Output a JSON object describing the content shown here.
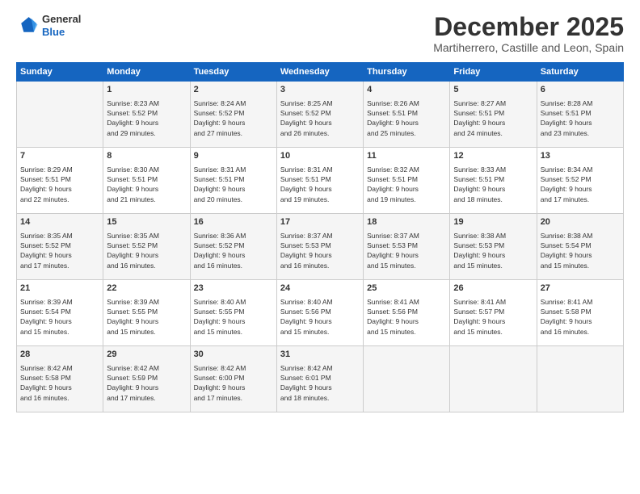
{
  "header": {
    "logo": {
      "line1": "General",
      "line2": "Blue"
    },
    "title": "December 2025",
    "subtitle": "Martiherrero, Castille and Leon, Spain"
  },
  "calendar": {
    "weekdays": [
      "Sunday",
      "Monday",
      "Tuesday",
      "Wednesday",
      "Thursday",
      "Friday",
      "Saturday"
    ],
    "weeks": [
      [
        {
          "day": "",
          "info": ""
        },
        {
          "day": "1",
          "info": "Sunrise: 8:23 AM\nSunset: 5:52 PM\nDaylight: 9 hours\nand 29 minutes."
        },
        {
          "day": "2",
          "info": "Sunrise: 8:24 AM\nSunset: 5:52 PM\nDaylight: 9 hours\nand 27 minutes."
        },
        {
          "day": "3",
          "info": "Sunrise: 8:25 AM\nSunset: 5:52 PM\nDaylight: 9 hours\nand 26 minutes."
        },
        {
          "day": "4",
          "info": "Sunrise: 8:26 AM\nSunset: 5:51 PM\nDaylight: 9 hours\nand 25 minutes."
        },
        {
          "day": "5",
          "info": "Sunrise: 8:27 AM\nSunset: 5:51 PM\nDaylight: 9 hours\nand 24 minutes."
        },
        {
          "day": "6",
          "info": "Sunrise: 8:28 AM\nSunset: 5:51 PM\nDaylight: 9 hours\nand 23 minutes."
        }
      ],
      [
        {
          "day": "7",
          "info": "Sunrise: 8:29 AM\nSunset: 5:51 PM\nDaylight: 9 hours\nand 22 minutes."
        },
        {
          "day": "8",
          "info": "Sunrise: 8:30 AM\nSunset: 5:51 PM\nDaylight: 9 hours\nand 21 minutes."
        },
        {
          "day": "9",
          "info": "Sunrise: 8:31 AM\nSunset: 5:51 PM\nDaylight: 9 hours\nand 20 minutes."
        },
        {
          "day": "10",
          "info": "Sunrise: 8:31 AM\nSunset: 5:51 PM\nDaylight: 9 hours\nand 19 minutes."
        },
        {
          "day": "11",
          "info": "Sunrise: 8:32 AM\nSunset: 5:51 PM\nDaylight: 9 hours\nand 19 minutes."
        },
        {
          "day": "12",
          "info": "Sunrise: 8:33 AM\nSunset: 5:51 PM\nDaylight: 9 hours\nand 18 minutes."
        },
        {
          "day": "13",
          "info": "Sunrise: 8:34 AM\nSunset: 5:52 PM\nDaylight: 9 hours\nand 17 minutes."
        }
      ],
      [
        {
          "day": "14",
          "info": "Sunrise: 8:35 AM\nSunset: 5:52 PM\nDaylight: 9 hours\nand 17 minutes."
        },
        {
          "day": "15",
          "info": "Sunrise: 8:35 AM\nSunset: 5:52 PM\nDaylight: 9 hours\nand 16 minutes."
        },
        {
          "day": "16",
          "info": "Sunrise: 8:36 AM\nSunset: 5:52 PM\nDaylight: 9 hours\nand 16 minutes."
        },
        {
          "day": "17",
          "info": "Sunrise: 8:37 AM\nSunset: 5:53 PM\nDaylight: 9 hours\nand 16 minutes."
        },
        {
          "day": "18",
          "info": "Sunrise: 8:37 AM\nSunset: 5:53 PM\nDaylight: 9 hours\nand 15 minutes."
        },
        {
          "day": "19",
          "info": "Sunrise: 8:38 AM\nSunset: 5:53 PM\nDaylight: 9 hours\nand 15 minutes."
        },
        {
          "day": "20",
          "info": "Sunrise: 8:38 AM\nSunset: 5:54 PM\nDaylight: 9 hours\nand 15 minutes."
        }
      ],
      [
        {
          "day": "21",
          "info": "Sunrise: 8:39 AM\nSunset: 5:54 PM\nDaylight: 9 hours\nand 15 minutes."
        },
        {
          "day": "22",
          "info": "Sunrise: 8:39 AM\nSunset: 5:55 PM\nDaylight: 9 hours\nand 15 minutes."
        },
        {
          "day": "23",
          "info": "Sunrise: 8:40 AM\nSunset: 5:55 PM\nDaylight: 9 hours\nand 15 minutes."
        },
        {
          "day": "24",
          "info": "Sunrise: 8:40 AM\nSunset: 5:56 PM\nDaylight: 9 hours\nand 15 minutes."
        },
        {
          "day": "25",
          "info": "Sunrise: 8:41 AM\nSunset: 5:56 PM\nDaylight: 9 hours\nand 15 minutes."
        },
        {
          "day": "26",
          "info": "Sunrise: 8:41 AM\nSunset: 5:57 PM\nDaylight: 9 hours\nand 15 minutes."
        },
        {
          "day": "27",
          "info": "Sunrise: 8:41 AM\nSunset: 5:58 PM\nDaylight: 9 hours\nand 16 minutes."
        }
      ],
      [
        {
          "day": "28",
          "info": "Sunrise: 8:42 AM\nSunset: 5:58 PM\nDaylight: 9 hours\nand 16 minutes."
        },
        {
          "day": "29",
          "info": "Sunrise: 8:42 AM\nSunset: 5:59 PM\nDaylight: 9 hours\nand 17 minutes."
        },
        {
          "day": "30",
          "info": "Sunrise: 8:42 AM\nSunset: 6:00 PM\nDaylight: 9 hours\nand 17 minutes."
        },
        {
          "day": "31",
          "info": "Sunrise: 8:42 AM\nSunset: 6:01 PM\nDaylight: 9 hours\nand 18 minutes."
        },
        {
          "day": "",
          "info": ""
        },
        {
          "day": "",
          "info": ""
        },
        {
          "day": "",
          "info": ""
        }
      ]
    ]
  }
}
